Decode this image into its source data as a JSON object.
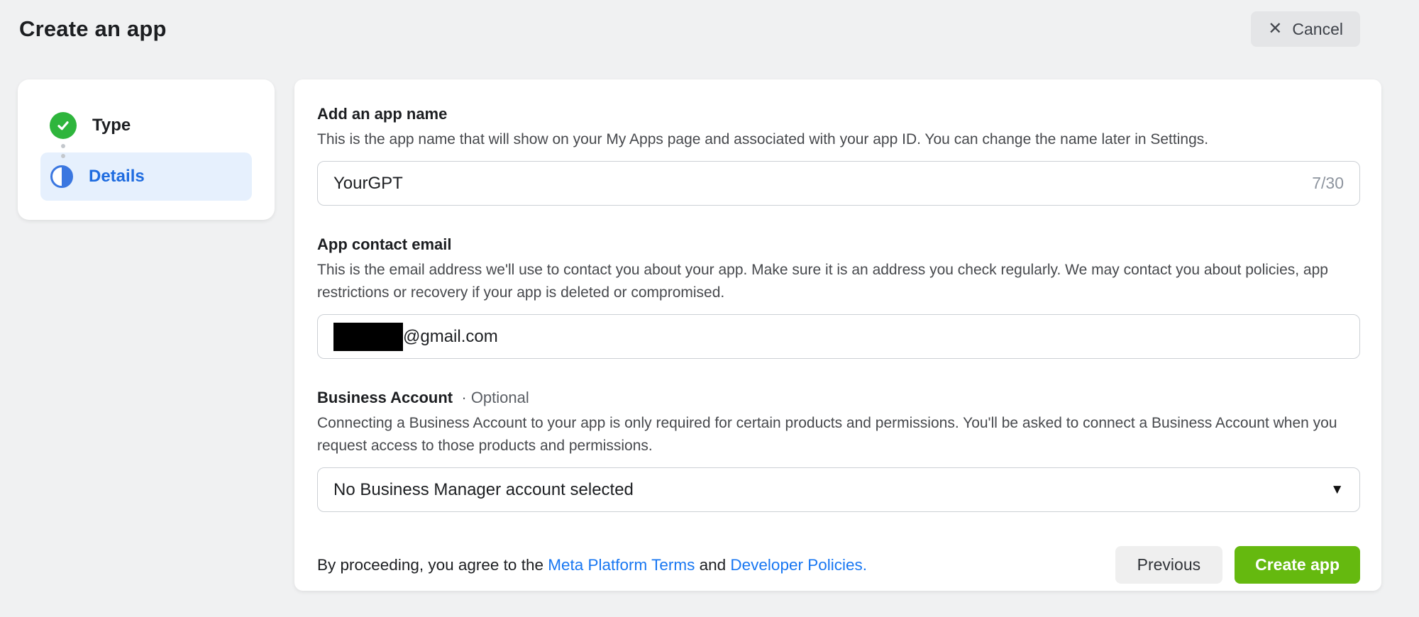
{
  "header": {
    "title": "Create an app",
    "cancel_label": "Cancel"
  },
  "stepper": {
    "steps": [
      {
        "label": "Type",
        "state": "complete"
      },
      {
        "label": "Details",
        "state": "active"
      }
    ]
  },
  "form": {
    "app_name": {
      "label": "Add an app name",
      "description": "This is the app name that will show on your My Apps page and associated with your app ID. You can change the name later in Settings.",
      "value": "YourGPT",
      "counter": "7/30"
    },
    "contact_email": {
      "label": "App contact email",
      "description": "This is the email address we'll use to contact you about your app. Make sure it is an address you check regularly. We may contact you about policies, app restrictions or recovery if your app is deleted or compromised.",
      "redacted": true,
      "value_visible_suffix": "@gmail.com"
    },
    "business_account": {
      "label": "Business Account",
      "optional_label": "· Optional",
      "description": "Connecting a Business Account to your app is only required for certain products and permissions. You'll be asked to connect a Business Account when you request access to those products and permissions.",
      "selected_value": "No Business Manager account selected"
    },
    "footer": {
      "terms_prefix": "By proceeding, you agree to the ",
      "terms_link_1": "Meta Platform Terms",
      "terms_middle": " and ",
      "terms_link_2": "Developer Policies.",
      "previous_label": "Previous",
      "create_label": "Create app"
    }
  },
  "icons": {
    "cancel_x": "✕",
    "dropdown_caret": "▼"
  },
  "colors": {
    "page_background": "#f0f1f2",
    "success_green": "#2eb53c",
    "active_step_blue": "#1f6ce0",
    "active_step_background": "#e6f0fd",
    "link_blue": "#1877f2",
    "create_button_green": "#65b90f"
  }
}
